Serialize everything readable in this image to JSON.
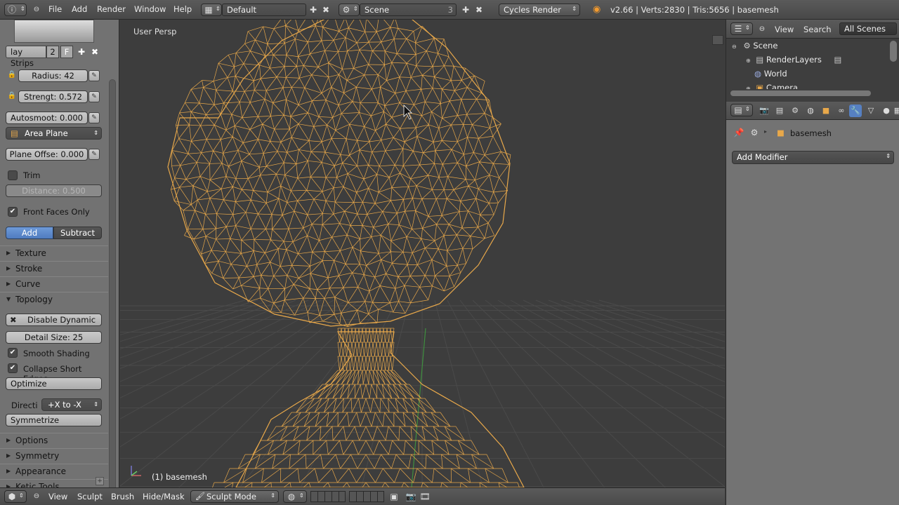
{
  "topbar": {
    "menus": [
      "File",
      "Add",
      "Render",
      "Window",
      "Help"
    ],
    "layout": "Default",
    "scene": "Scene",
    "scene_users": "3",
    "render_engine": "Cycles Render",
    "stats": "v2.66 | Verts:2830 | Tris:5656 | basemesh"
  },
  "leftpanel": {
    "brush_tab": "lay Strips",
    "brush_users": "2",
    "brush_fake": "F",
    "radius": "Radius: 42",
    "strength": "Strengt: 0.572",
    "autosmooth": "Autosmoot: 0.000",
    "area_plane": "Area Plane",
    "plane_offset": "Plane Offse: 0.000",
    "trim": "Trim",
    "distance": "Distance: 0.500",
    "front_faces": "Front Faces Only",
    "add": "Add",
    "subtract": "Subtract",
    "sections1": [
      "Texture",
      "Stroke",
      "Curve"
    ],
    "topology": "Topology",
    "disable_dynamic": "Disable Dynamic",
    "detail_size": "Detail Size: 25",
    "smooth_shading": "Smooth Shading",
    "collapse_edges": "Collapse Short Edges",
    "optimize": "Optimize",
    "direction_label": "Directi",
    "direction_value": "+X to -X",
    "symmetrize": "Symmetrize",
    "sections2": [
      "Options",
      "Symmetry",
      "Appearance",
      "Ketic Tools"
    ]
  },
  "viewport": {
    "view_name": "User Persp",
    "object_name": "(1) basemesh"
  },
  "bottombar": {
    "menus": [
      "View",
      "Sculpt",
      "Brush",
      "Hide/Mask"
    ],
    "mode": "Sculpt Mode"
  },
  "outliner": {
    "view": "View",
    "search": "Search",
    "filter": "All Scenes",
    "rows": [
      "Scene",
      "RenderLayers",
      "World",
      "Camera"
    ]
  },
  "properties": {
    "object": "basemesh",
    "add_modifier": "Add Modifier"
  },
  "colors": {
    "wire": "#e8a84a",
    "grid": "#4a4a4a",
    "accent": "#5680c2"
  }
}
